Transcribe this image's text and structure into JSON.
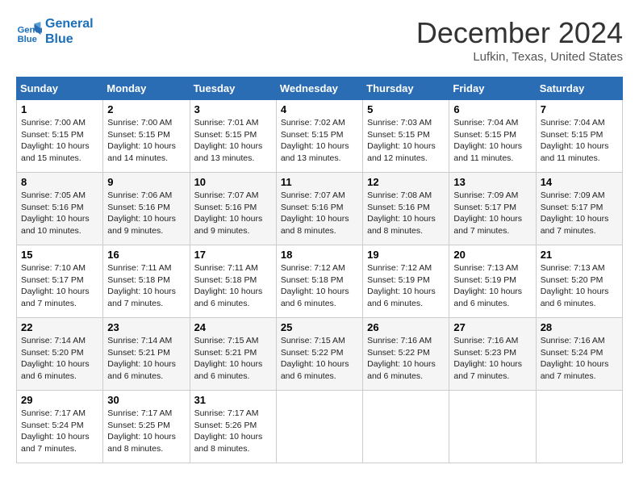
{
  "logo": {
    "line1": "General",
    "line2": "Blue"
  },
  "title": "December 2024",
  "location": "Lufkin, Texas, United States",
  "days_of_week": [
    "Sunday",
    "Monday",
    "Tuesday",
    "Wednesday",
    "Thursday",
    "Friday",
    "Saturday"
  ],
  "weeks": [
    [
      {
        "day": "1",
        "sunrise": "7:00 AM",
        "sunset": "5:15 PM",
        "daylight": "10 hours and 15 minutes."
      },
      {
        "day": "2",
        "sunrise": "7:00 AM",
        "sunset": "5:15 PM",
        "daylight": "10 hours and 14 minutes."
      },
      {
        "day": "3",
        "sunrise": "7:01 AM",
        "sunset": "5:15 PM",
        "daylight": "10 hours and 13 minutes."
      },
      {
        "day": "4",
        "sunrise": "7:02 AM",
        "sunset": "5:15 PM",
        "daylight": "10 hours and 13 minutes."
      },
      {
        "day": "5",
        "sunrise": "7:03 AM",
        "sunset": "5:15 PM",
        "daylight": "10 hours and 12 minutes."
      },
      {
        "day": "6",
        "sunrise": "7:04 AM",
        "sunset": "5:15 PM",
        "daylight": "10 hours and 11 minutes."
      },
      {
        "day": "7",
        "sunrise": "7:04 AM",
        "sunset": "5:15 PM",
        "daylight": "10 hours and 11 minutes."
      }
    ],
    [
      {
        "day": "8",
        "sunrise": "7:05 AM",
        "sunset": "5:16 PM",
        "daylight": "10 hours and 10 minutes."
      },
      {
        "day": "9",
        "sunrise": "7:06 AM",
        "sunset": "5:16 PM",
        "daylight": "10 hours and 9 minutes."
      },
      {
        "day": "10",
        "sunrise": "7:07 AM",
        "sunset": "5:16 PM",
        "daylight": "10 hours and 9 minutes."
      },
      {
        "day": "11",
        "sunrise": "7:07 AM",
        "sunset": "5:16 PM",
        "daylight": "10 hours and 8 minutes."
      },
      {
        "day": "12",
        "sunrise": "7:08 AM",
        "sunset": "5:16 PM",
        "daylight": "10 hours and 8 minutes."
      },
      {
        "day": "13",
        "sunrise": "7:09 AM",
        "sunset": "5:17 PM",
        "daylight": "10 hours and 7 minutes."
      },
      {
        "day": "14",
        "sunrise": "7:09 AM",
        "sunset": "5:17 PM",
        "daylight": "10 hours and 7 minutes."
      }
    ],
    [
      {
        "day": "15",
        "sunrise": "7:10 AM",
        "sunset": "5:17 PM",
        "daylight": "10 hours and 7 minutes."
      },
      {
        "day": "16",
        "sunrise": "7:11 AM",
        "sunset": "5:18 PM",
        "daylight": "10 hours and 7 minutes."
      },
      {
        "day": "17",
        "sunrise": "7:11 AM",
        "sunset": "5:18 PM",
        "daylight": "10 hours and 6 minutes."
      },
      {
        "day": "18",
        "sunrise": "7:12 AM",
        "sunset": "5:18 PM",
        "daylight": "10 hours and 6 minutes."
      },
      {
        "day": "19",
        "sunrise": "7:12 AM",
        "sunset": "5:19 PM",
        "daylight": "10 hours and 6 minutes."
      },
      {
        "day": "20",
        "sunrise": "7:13 AM",
        "sunset": "5:19 PM",
        "daylight": "10 hours and 6 minutes."
      },
      {
        "day": "21",
        "sunrise": "7:13 AM",
        "sunset": "5:20 PM",
        "daylight": "10 hours and 6 minutes."
      }
    ],
    [
      {
        "day": "22",
        "sunrise": "7:14 AM",
        "sunset": "5:20 PM",
        "daylight": "10 hours and 6 minutes."
      },
      {
        "day": "23",
        "sunrise": "7:14 AM",
        "sunset": "5:21 PM",
        "daylight": "10 hours and 6 minutes."
      },
      {
        "day": "24",
        "sunrise": "7:15 AM",
        "sunset": "5:21 PM",
        "daylight": "10 hours and 6 minutes."
      },
      {
        "day": "25",
        "sunrise": "7:15 AM",
        "sunset": "5:22 PM",
        "daylight": "10 hours and 6 minutes."
      },
      {
        "day": "26",
        "sunrise": "7:16 AM",
        "sunset": "5:22 PM",
        "daylight": "10 hours and 6 minutes."
      },
      {
        "day": "27",
        "sunrise": "7:16 AM",
        "sunset": "5:23 PM",
        "daylight": "10 hours and 7 minutes."
      },
      {
        "day": "28",
        "sunrise": "7:16 AM",
        "sunset": "5:24 PM",
        "daylight": "10 hours and 7 minutes."
      }
    ],
    [
      {
        "day": "29",
        "sunrise": "7:17 AM",
        "sunset": "5:24 PM",
        "daylight": "10 hours and 7 minutes."
      },
      {
        "day": "30",
        "sunrise": "7:17 AM",
        "sunset": "5:25 PM",
        "daylight": "10 hours and 8 minutes."
      },
      {
        "day": "31",
        "sunrise": "7:17 AM",
        "sunset": "5:26 PM",
        "daylight": "10 hours and 8 minutes."
      },
      null,
      null,
      null,
      null
    ]
  ],
  "labels": {
    "sunrise": "Sunrise:",
    "sunset": "Sunset:",
    "daylight": "Daylight:"
  }
}
